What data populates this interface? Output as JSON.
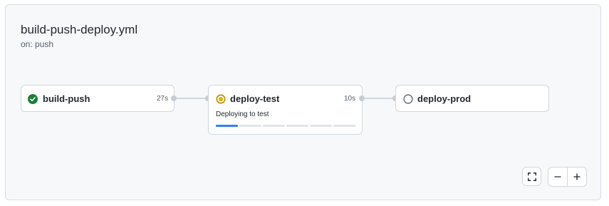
{
  "workflow": {
    "title": "build-push-deploy.yml",
    "trigger": "on: push"
  },
  "jobs": [
    {
      "name": "build-push",
      "duration": "27s",
      "status": "success",
      "icon": "check-circle-fill-icon"
    },
    {
      "name": "deploy-test",
      "duration": "10s",
      "status": "in_progress",
      "icon": "in-progress-icon",
      "message": "Deploying to test",
      "progress_segments_total": 6,
      "progress_segments_filled": 1
    },
    {
      "name": "deploy-prod",
      "duration": "",
      "status": "pending",
      "icon": "circle-outline-icon"
    }
  ],
  "controls": {
    "fullscreen_icon": "fullscreen-icon",
    "zoom_out_icon": "minus-icon",
    "zoom_in_icon": "plus-icon"
  },
  "colors": {
    "success": "#1a7f37",
    "in_progress": "#bf8700",
    "progress_active": "#2f81f7",
    "pending": "#57606a"
  }
}
